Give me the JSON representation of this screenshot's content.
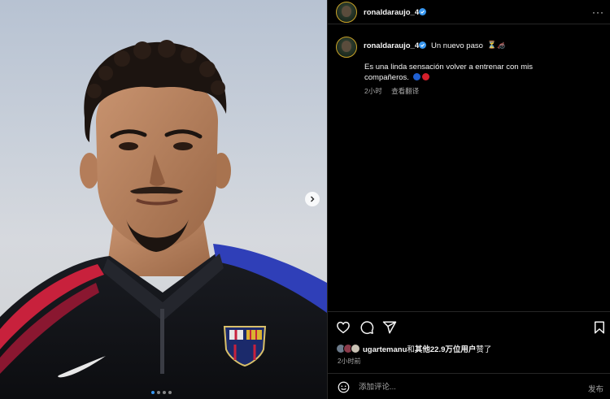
{
  "post": {
    "username": "ronaldaraujo_4",
    "more_label": "···"
  },
  "caption": {
    "username": "ronaldaraujo_4",
    "title": "Un nuevo paso",
    "title_emoji": "⏳🦽",
    "body": "Es una linda sensación volver a entrenar con mis compañeros.",
    "time": "2小时",
    "translate": "查看翻译"
  },
  "likes": {
    "liker": "ugartemanu",
    "connector": "和",
    "others": "其他22.9万位用户",
    "suffix": "赞了"
  },
  "post_time": "2小时前",
  "comment": {
    "placeholder": "添加评论...",
    "post_label": "发布"
  },
  "carousel": {
    "slides": 4,
    "active_slide": 1
  },
  "colors": {
    "verified": "#3897f0",
    "flag_blue": "#1f5fd1",
    "flag_red": "#d41f2a"
  }
}
